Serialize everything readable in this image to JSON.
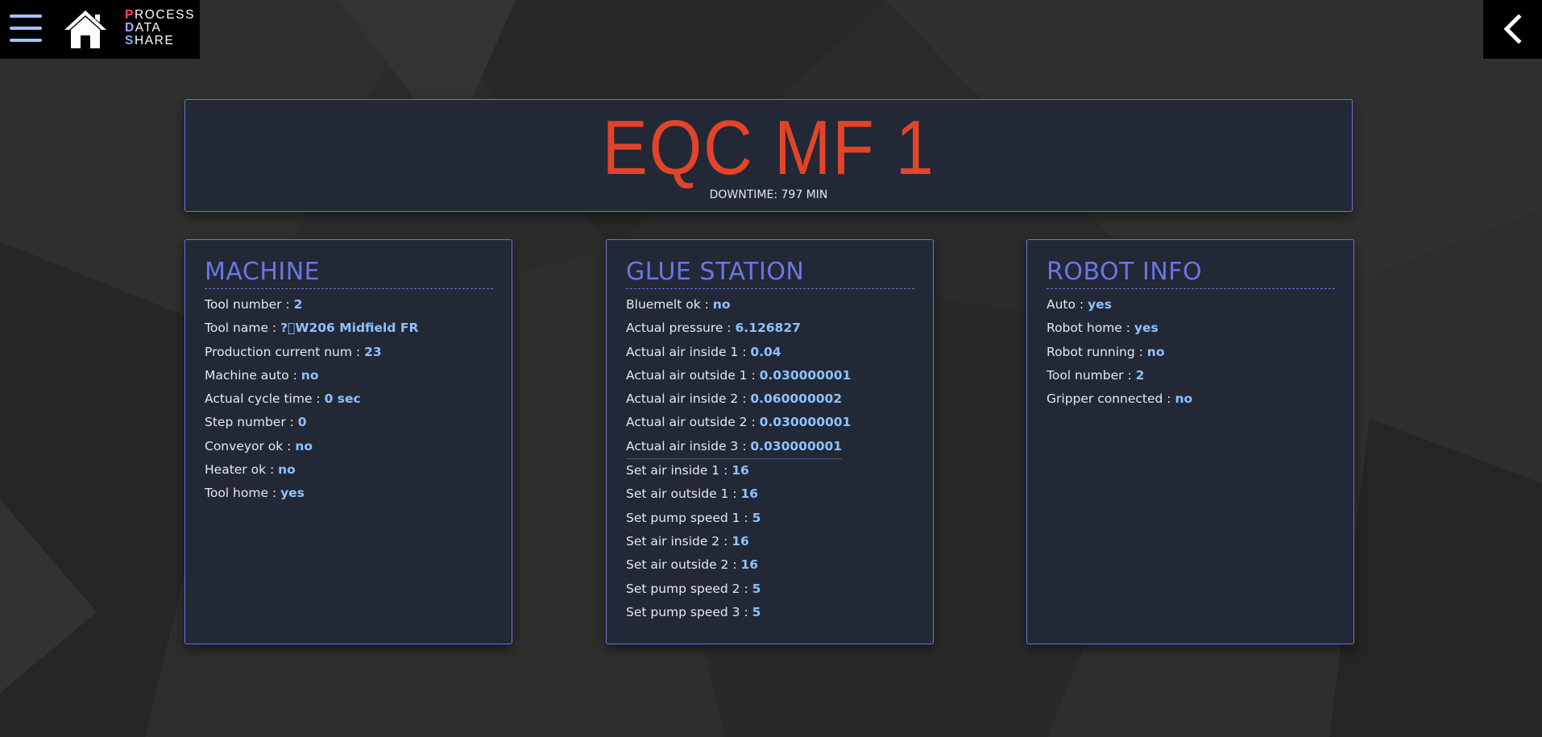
{
  "nav": {
    "logo": {
      "line1_first": "P",
      "line1_rest": "ROCESS",
      "line2_first": "D",
      "line2_rest": "ATA",
      "line3_first": "S",
      "line3_rest": "HARE"
    }
  },
  "header": {
    "title": "EQC MF 1",
    "downtime": "DOWNTIME: 797 MIN"
  },
  "panels": {
    "machine": {
      "title": "MACHINE",
      "rows": [
        {
          "label": "Tool number : ",
          "value": "2"
        },
        {
          "label": "Tool name : ",
          "value": "?\u0000W206 Midfield FR"
        },
        {
          "label": "Production current num : ",
          "value": "23"
        },
        {
          "label": "Machine auto : ",
          "value": "no"
        },
        {
          "label": "Actual cycle time : ",
          "value": "0 sec"
        },
        {
          "label": "Step number : ",
          "value": "0"
        },
        {
          "label": "Conveyor ok : ",
          "value": "no"
        },
        {
          "label": "Heater ok : ",
          "value": "no"
        },
        {
          "label": "Tool home : ",
          "value": "yes"
        }
      ]
    },
    "glue": {
      "title": "GLUE STATION",
      "rows": [
        {
          "label": "Bluemelt ok : ",
          "value": "no"
        },
        {
          "label": "Actual pressure : ",
          "value": "6.126827"
        },
        {
          "label": "Actual air inside 1 : ",
          "value": "0.04"
        },
        {
          "label": "Actual air outside 1 : ",
          "value": "0.030000001"
        },
        {
          "label": "Actual air inside 2 : ",
          "value": "0.060000002"
        },
        {
          "label": "Actual air outside 2 : ",
          "value": "0.030000001"
        },
        {
          "label": "Actual air inside 3 : ",
          "value": "0.030000001"
        },
        {
          "label": "Set air inside 1 : ",
          "value": "16"
        },
        {
          "label": "Set air outside 1 : ",
          "value": "16"
        },
        {
          "label": "Set pump speed 1 : ",
          "value": "5"
        },
        {
          "label": "Set air inside 2 : ",
          "value": "16"
        },
        {
          "label": "Set air outside 2 : ",
          "value": "16"
        },
        {
          "label": "Set pump speed 2 : ",
          "value": "5"
        },
        {
          "label": "Set pump speed 3 : ",
          "value": "5"
        }
      ]
    },
    "robot": {
      "title": "ROBOT INFO",
      "rows": [
        {
          "label": "Auto : ",
          "value": "yes"
        },
        {
          "label": "Robot home : ",
          "value": "yes"
        },
        {
          "label": "Robot running : ",
          "value": "no"
        },
        {
          "label": "Tool number : ",
          "value": "2"
        },
        {
          "label": "Gripper connected : ",
          "value": "no"
        }
      ]
    }
  },
  "colors": {
    "accent": "#6d75e6",
    "title_red": "#e2442a",
    "value_blue": "#8ec1ff",
    "panel_bg": "#222835"
  }
}
